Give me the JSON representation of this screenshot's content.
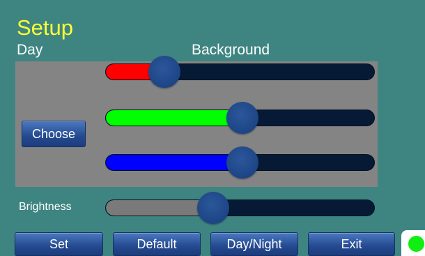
{
  "header": {
    "title": "Setup",
    "mode_label": "Day",
    "section_label": "Background"
  },
  "colors": {
    "background": "#3e8582",
    "title": "#ffff33",
    "panel": "#848484",
    "track": "#061a36",
    "knob": "#1d4586",
    "status_indicator": "#11ee11"
  },
  "panel": {
    "choose_label": "Choose"
  },
  "sliders": [
    {
      "name": "red",
      "value_fraction": 0.22,
      "fill_color": "#ff0000"
    },
    {
      "name": "green",
      "value_fraction": 0.51,
      "fill_color": "#00ff00"
    },
    {
      "name": "blue",
      "value_fraction": 0.51,
      "fill_color": "#0000ff"
    }
  ],
  "brightness": {
    "label": "Brightness",
    "value_fraction": 0.4,
    "fill_color": "#7a7a7a"
  },
  "buttons": {
    "set": "Set",
    "default": "Default",
    "day_night": "Day/Night",
    "exit": "Exit"
  },
  "status": {
    "icon": "status-indicator-icon"
  }
}
